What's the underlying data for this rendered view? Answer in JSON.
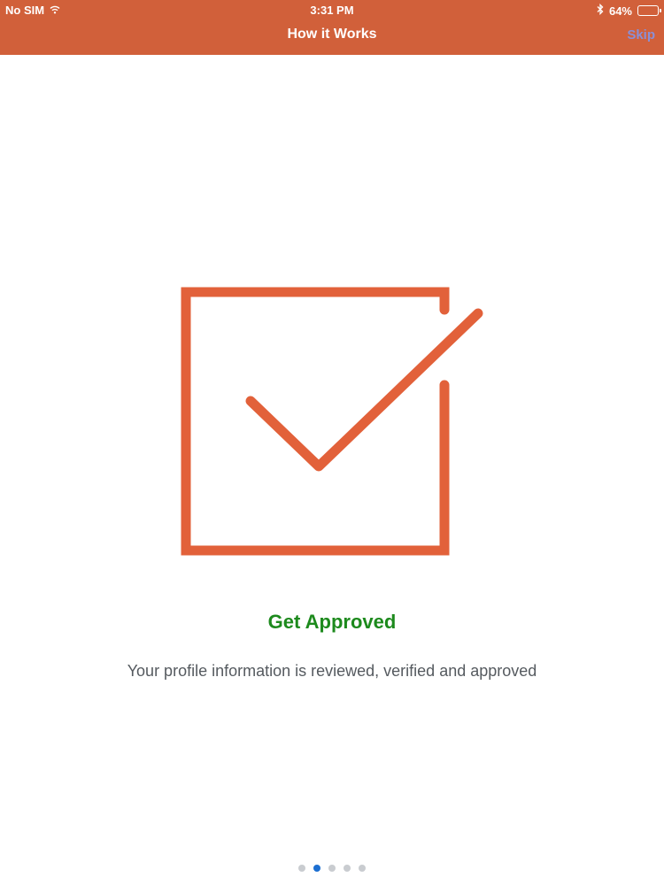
{
  "status_bar": {
    "carrier": "No SIM",
    "time": "3:31 PM",
    "battery_percent": "64%",
    "battery_level": 0.64
  },
  "nav": {
    "title": "How it Works",
    "skip_label": "Skip"
  },
  "slide": {
    "icon": "checkbox-checked-icon",
    "title": "Get Approved",
    "description": "Your profile information is reviewed, verified and approved"
  },
  "pager": {
    "count": 5,
    "active_index": 1
  },
  "colors": {
    "header": "#d1603a",
    "accent": "#e2613a",
    "title_green": "#1d8a1d",
    "skip": "#8a8fd6",
    "dot_active": "#1c6fd1",
    "dot_inactive": "#c9ccd0"
  }
}
